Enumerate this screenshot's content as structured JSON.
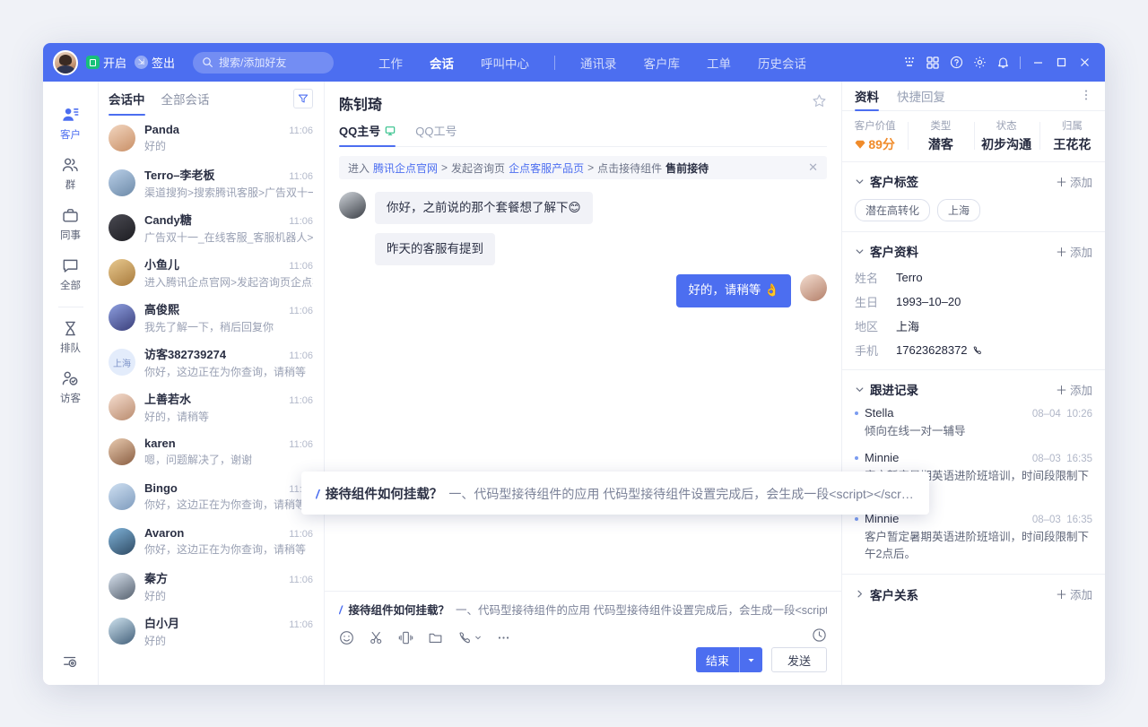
{
  "titlebar": {
    "status_label": "开启",
    "signout_label": "签出",
    "search_placeholder": "搜索/添加好友",
    "nav": [
      {
        "label": "工作",
        "active": false
      },
      {
        "label": "会话",
        "active": true
      },
      {
        "label": "呼叫中心",
        "active": false
      },
      {
        "label": "通讯录",
        "active": false
      },
      {
        "label": "客户库",
        "active": false
      },
      {
        "label": "工单",
        "active": false
      },
      {
        "label": "历史会话",
        "active": false
      }
    ],
    "accent": "#4c6ef0"
  },
  "rail": {
    "items": [
      {
        "label": "客户",
        "icon": "customer-icon",
        "active": true
      },
      {
        "label": "群",
        "icon": "group-icon",
        "active": false
      },
      {
        "label": "同事",
        "icon": "briefcase-icon",
        "active": false
      },
      {
        "label": "全部",
        "icon": "chat-bubble-icon",
        "active": false
      },
      {
        "label": "排队",
        "icon": "hourglass-icon",
        "active": false
      },
      {
        "label": "访客",
        "icon": "visitor-check-icon",
        "active": false
      }
    ]
  },
  "conversation_list": {
    "tabs": [
      {
        "label": "会话中",
        "active": true
      },
      {
        "label": "全部会话",
        "active": false
      }
    ],
    "items": [
      {
        "name": "Panda",
        "preview": "好的",
        "time": "11:06"
      },
      {
        "name": "Terro–李老板",
        "preview": "渠道搜狗>搜索腾讯客服>广告双十一_在线",
        "time": "11:06"
      },
      {
        "name": "Candy糖",
        "preview": "广告双十一_在线客服_客服机器人>进入腾",
        "time": "11:06"
      },
      {
        "name": "小鱼儿",
        "preview": "进入腾讯企点官网>发起咨询页企点客服产",
        "time": "11:06"
      },
      {
        "name": "高俊熙",
        "preview": "我先了解一下，稍后回复你",
        "time": "11:06"
      },
      {
        "name": "访客382739274",
        "preview": "你好，这边正在为你查询，请稍等",
        "time": "11:06",
        "avatar_text": "上海"
      },
      {
        "name": "上善若水",
        "preview": "好的，请稍等",
        "time": "11:06"
      },
      {
        "name": "karen",
        "preview": "嗯，问题解决了，谢谢",
        "time": "11:06"
      },
      {
        "name": "Bingo",
        "preview": "你好，这边正在为你查询，请稍等",
        "time": "11:06"
      },
      {
        "name": "Avaron",
        "preview": "你好，这边正在为你查询，请稍等",
        "time": "11:06"
      },
      {
        "name": "秦方",
        "preview": "好的",
        "time": "11:06"
      },
      {
        "name": "白小月",
        "preview": "好的",
        "time": "11:06"
      }
    ]
  },
  "chat": {
    "title": "陈钊琦",
    "tabs": [
      {
        "label": "QQ主号",
        "active": true
      },
      {
        "label": "QQ工号",
        "active": false
      }
    ],
    "breadcrumb": {
      "prefix": "进入",
      "link1": "腾讯企点官网",
      "sep1": ">",
      "mid": "发起咨询页",
      "link2": "企点客服产品页",
      "sep2": ">",
      "tail": "点击接待组件",
      "strong": "售前接待"
    },
    "messages": [
      {
        "side": "in",
        "text": "你好，之前说的那个套餐想了解下😊"
      },
      {
        "side": "in",
        "text": "昨天的客服有提到"
      },
      {
        "side": "out",
        "text": "好的，请稍等 👌"
      }
    ],
    "composer": {
      "slash": "/",
      "hint_title": "接待组件如何挂载？",
      "hint_body": "一、代码型接待组件的应用 代码型接待组件设置完成后，会生成一段<script></scr…",
      "tools": [
        "emoji-icon",
        "scissors-icon",
        "shake-icon",
        "folder-icon",
        "phone-icon",
        "more-icon"
      ],
      "history_icon": "history-clock-icon",
      "end_label": "结束",
      "send_label": "发送"
    },
    "popup": {
      "slash": "/",
      "title": "接待组件如何挂载？",
      "body": "一、代码型接待组件的应用 代码型接待组件设置完成后，会生成一段<script></scr…"
    }
  },
  "right_panel": {
    "tabs": [
      {
        "label": "资料",
        "active": true
      },
      {
        "label": "快捷回复",
        "active": false
      }
    ],
    "stats": [
      {
        "key": "客户价值",
        "value": "89分",
        "icon": "gem-icon",
        "color": "#f08b2a"
      },
      {
        "key": "类型",
        "value": "潜客"
      },
      {
        "key": "状态",
        "value": "初步沟通"
      },
      {
        "key": "归属",
        "value": "王花花"
      }
    ],
    "tags_section": {
      "title": "客户标签",
      "add_label": "添加",
      "tags": [
        "潜在高转化",
        "上海"
      ]
    },
    "profile_section": {
      "title": "客户资料",
      "add_label": "添加",
      "fields": [
        {
          "key": "姓名",
          "value": "Terro"
        },
        {
          "key": "生日",
          "value": "1993–10–20"
        },
        {
          "key": "地区",
          "value": "上海"
        },
        {
          "key": "手机",
          "value": "17623628372",
          "icon": "phone-icon"
        }
      ]
    },
    "followup_section": {
      "title": "跟进记录",
      "add_label": "添加",
      "entries": [
        {
          "name": "Stella",
          "date": "08–04",
          "time": "10:26",
          "body": "倾向在线一对一辅导"
        },
        {
          "name": "Minnie",
          "date": "08–03",
          "time": "16:35",
          "body": "客户暂定暑期英语进阶班培训，时间段限制下午2点后。"
        },
        {
          "name": "Minnie",
          "date": "08–03",
          "time": "16:35",
          "body": "客户暂定暑期英语进阶班培训，时间段限制下午2点后。"
        }
      ]
    },
    "relation_section": {
      "title": "客户关系",
      "add_label": "添加"
    }
  }
}
